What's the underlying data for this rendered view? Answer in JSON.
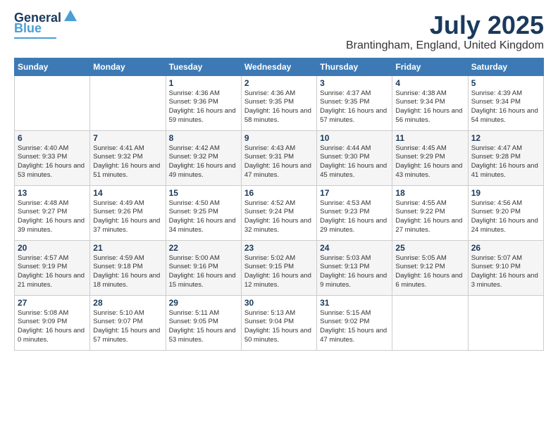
{
  "logo": {
    "line1": "General",
    "line2": "Blue"
  },
  "title": "July 2025",
  "subtitle": "Brantingham, England, United Kingdom",
  "days_of_week": [
    "Sunday",
    "Monday",
    "Tuesday",
    "Wednesday",
    "Thursday",
    "Friday",
    "Saturday"
  ],
  "weeks": [
    [
      {
        "day": "",
        "info": ""
      },
      {
        "day": "",
        "info": ""
      },
      {
        "day": "1",
        "info": "Sunrise: 4:36 AM\nSunset: 9:36 PM\nDaylight: 16 hours and 59 minutes."
      },
      {
        "day": "2",
        "info": "Sunrise: 4:36 AM\nSunset: 9:35 PM\nDaylight: 16 hours and 58 minutes."
      },
      {
        "day": "3",
        "info": "Sunrise: 4:37 AM\nSunset: 9:35 PM\nDaylight: 16 hours and 57 minutes."
      },
      {
        "day": "4",
        "info": "Sunrise: 4:38 AM\nSunset: 9:34 PM\nDaylight: 16 hours and 56 minutes."
      },
      {
        "day": "5",
        "info": "Sunrise: 4:39 AM\nSunset: 9:34 PM\nDaylight: 16 hours and 54 minutes."
      }
    ],
    [
      {
        "day": "6",
        "info": "Sunrise: 4:40 AM\nSunset: 9:33 PM\nDaylight: 16 hours and 53 minutes."
      },
      {
        "day": "7",
        "info": "Sunrise: 4:41 AM\nSunset: 9:32 PM\nDaylight: 16 hours and 51 minutes."
      },
      {
        "day": "8",
        "info": "Sunrise: 4:42 AM\nSunset: 9:32 PM\nDaylight: 16 hours and 49 minutes."
      },
      {
        "day": "9",
        "info": "Sunrise: 4:43 AM\nSunset: 9:31 PM\nDaylight: 16 hours and 47 minutes."
      },
      {
        "day": "10",
        "info": "Sunrise: 4:44 AM\nSunset: 9:30 PM\nDaylight: 16 hours and 45 minutes."
      },
      {
        "day": "11",
        "info": "Sunrise: 4:45 AM\nSunset: 9:29 PM\nDaylight: 16 hours and 43 minutes."
      },
      {
        "day": "12",
        "info": "Sunrise: 4:47 AM\nSunset: 9:28 PM\nDaylight: 16 hours and 41 minutes."
      }
    ],
    [
      {
        "day": "13",
        "info": "Sunrise: 4:48 AM\nSunset: 9:27 PM\nDaylight: 16 hours and 39 minutes."
      },
      {
        "day": "14",
        "info": "Sunrise: 4:49 AM\nSunset: 9:26 PM\nDaylight: 16 hours and 37 minutes."
      },
      {
        "day": "15",
        "info": "Sunrise: 4:50 AM\nSunset: 9:25 PM\nDaylight: 16 hours and 34 minutes."
      },
      {
        "day": "16",
        "info": "Sunrise: 4:52 AM\nSunset: 9:24 PM\nDaylight: 16 hours and 32 minutes."
      },
      {
        "day": "17",
        "info": "Sunrise: 4:53 AM\nSunset: 9:23 PM\nDaylight: 16 hours and 29 minutes."
      },
      {
        "day": "18",
        "info": "Sunrise: 4:55 AM\nSunset: 9:22 PM\nDaylight: 16 hours and 27 minutes."
      },
      {
        "day": "19",
        "info": "Sunrise: 4:56 AM\nSunset: 9:20 PM\nDaylight: 16 hours and 24 minutes."
      }
    ],
    [
      {
        "day": "20",
        "info": "Sunrise: 4:57 AM\nSunset: 9:19 PM\nDaylight: 16 hours and 21 minutes."
      },
      {
        "day": "21",
        "info": "Sunrise: 4:59 AM\nSunset: 9:18 PM\nDaylight: 16 hours and 18 minutes."
      },
      {
        "day": "22",
        "info": "Sunrise: 5:00 AM\nSunset: 9:16 PM\nDaylight: 16 hours and 15 minutes."
      },
      {
        "day": "23",
        "info": "Sunrise: 5:02 AM\nSunset: 9:15 PM\nDaylight: 16 hours and 12 minutes."
      },
      {
        "day": "24",
        "info": "Sunrise: 5:03 AM\nSunset: 9:13 PM\nDaylight: 16 hours and 9 minutes."
      },
      {
        "day": "25",
        "info": "Sunrise: 5:05 AM\nSunset: 9:12 PM\nDaylight: 16 hours and 6 minutes."
      },
      {
        "day": "26",
        "info": "Sunrise: 5:07 AM\nSunset: 9:10 PM\nDaylight: 16 hours and 3 minutes."
      }
    ],
    [
      {
        "day": "27",
        "info": "Sunrise: 5:08 AM\nSunset: 9:09 PM\nDaylight: 16 hours and 0 minutes."
      },
      {
        "day": "28",
        "info": "Sunrise: 5:10 AM\nSunset: 9:07 PM\nDaylight: 15 hours and 57 minutes."
      },
      {
        "day": "29",
        "info": "Sunrise: 5:11 AM\nSunset: 9:05 PM\nDaylight: 15 hours and 53 minutes."
      },
      {
        "day": "30",
        "info": "Sunrise: 5:13 AM\nSunset: 9:04 PM\nDaylight: 15 hours and 50 minutes."
      },
      {
        "day": "31",
        "info": "Sunrise: 5:15 AM\nSunset: 9:02 PM\nDaylight: 15 hours and 47 minutes."
      },
      {
        "day": "",
        "info": ""
      },
      {
        "day": "",
        "info": ""
      }
    ]
  ]
}
